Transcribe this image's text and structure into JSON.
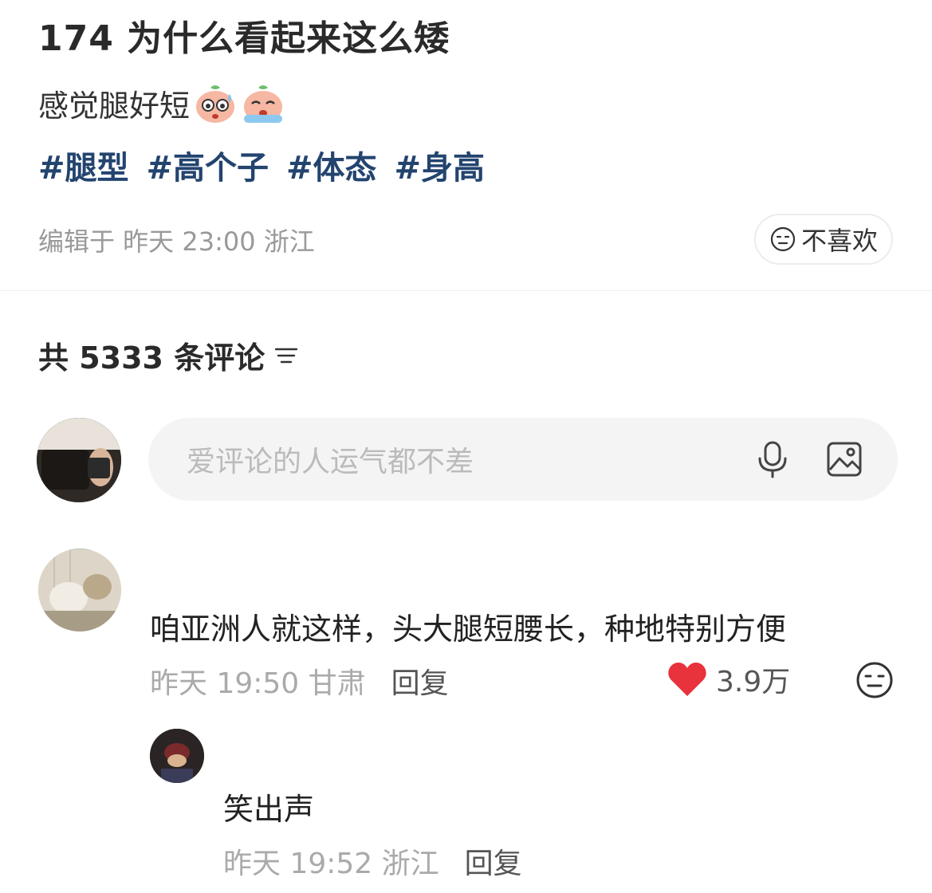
{
  "post": {
    "title": "174 为什么看起来这么矮",
    "body": "感觉腿好短",
    "emojis": [
      "sweat-face-emoji",
      "crying-face-emoji"
    ],
    "tags": [
      "#腿型",
      "#高个子",
      "#体态",
      "#身高"
    ],
    "meta": "编辑于 昨天 23:00 浙江",
    "dislike_label": "不喜欢"
  },
  "comments_header": {
    "label": "共 5333 条评论"
  },
  "comment_input": {
    "placeholder": "爱评论的人运气都不差"
  },
  "comments": [
    {
      "text": "咱亚洲人就这样，头大腿短腰长，种地特别方便",
      "meta": "昨天 19:50 甘肃",
      "reply_label": "回复",
      "likes": "3.9万"
    },
    {
      "text": "笑出声",
      "meta": "昨天 19:52 浙江",
      "reply_label": "回复"
    }
  ],
  "colors": {
    "tag": "#23446f",
    "heart": "#e8323c",
    "muted": "#999999"
  }
}
